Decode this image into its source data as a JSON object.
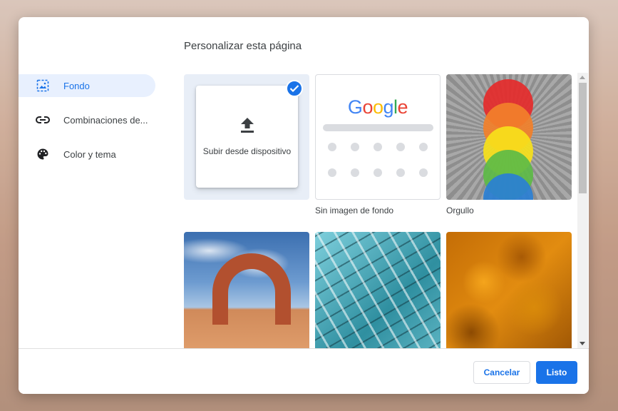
{
  "dialog": {
    "title": "Personalizar esta página"
  },
  "sidebar": {
    "items": [
      {
        "label": "Fondo",
        "icon": "background-image-icon",
        "active": true
      },
      {
        "label": "Combinaciones de...",
        "icon": "link-icon",
        "active": false
      },
      {
        "label": "Color y tema",
        "icon": "palette-icon",
        "active": false
      }
    ]
  },
  "tiles": {
    "upload": {
      "label": "Subir desde dispositivo",
      "icon": "upload-icon",
      "selected": true
    },
    "no_image": {
      "caption": "Sin imagen de fondo",
      "logo_text": "Google"
    },
    "pride": {
      "caption": "Orgullo"
    }
  },
  "footer": {
    "cancel_label": "Cancelar",
    "done_label": "Listo"
  },
  "colors": {
    "accent": "#1a73e8",
    "active_nav_bg": "#e8f0fe"
  }
}
